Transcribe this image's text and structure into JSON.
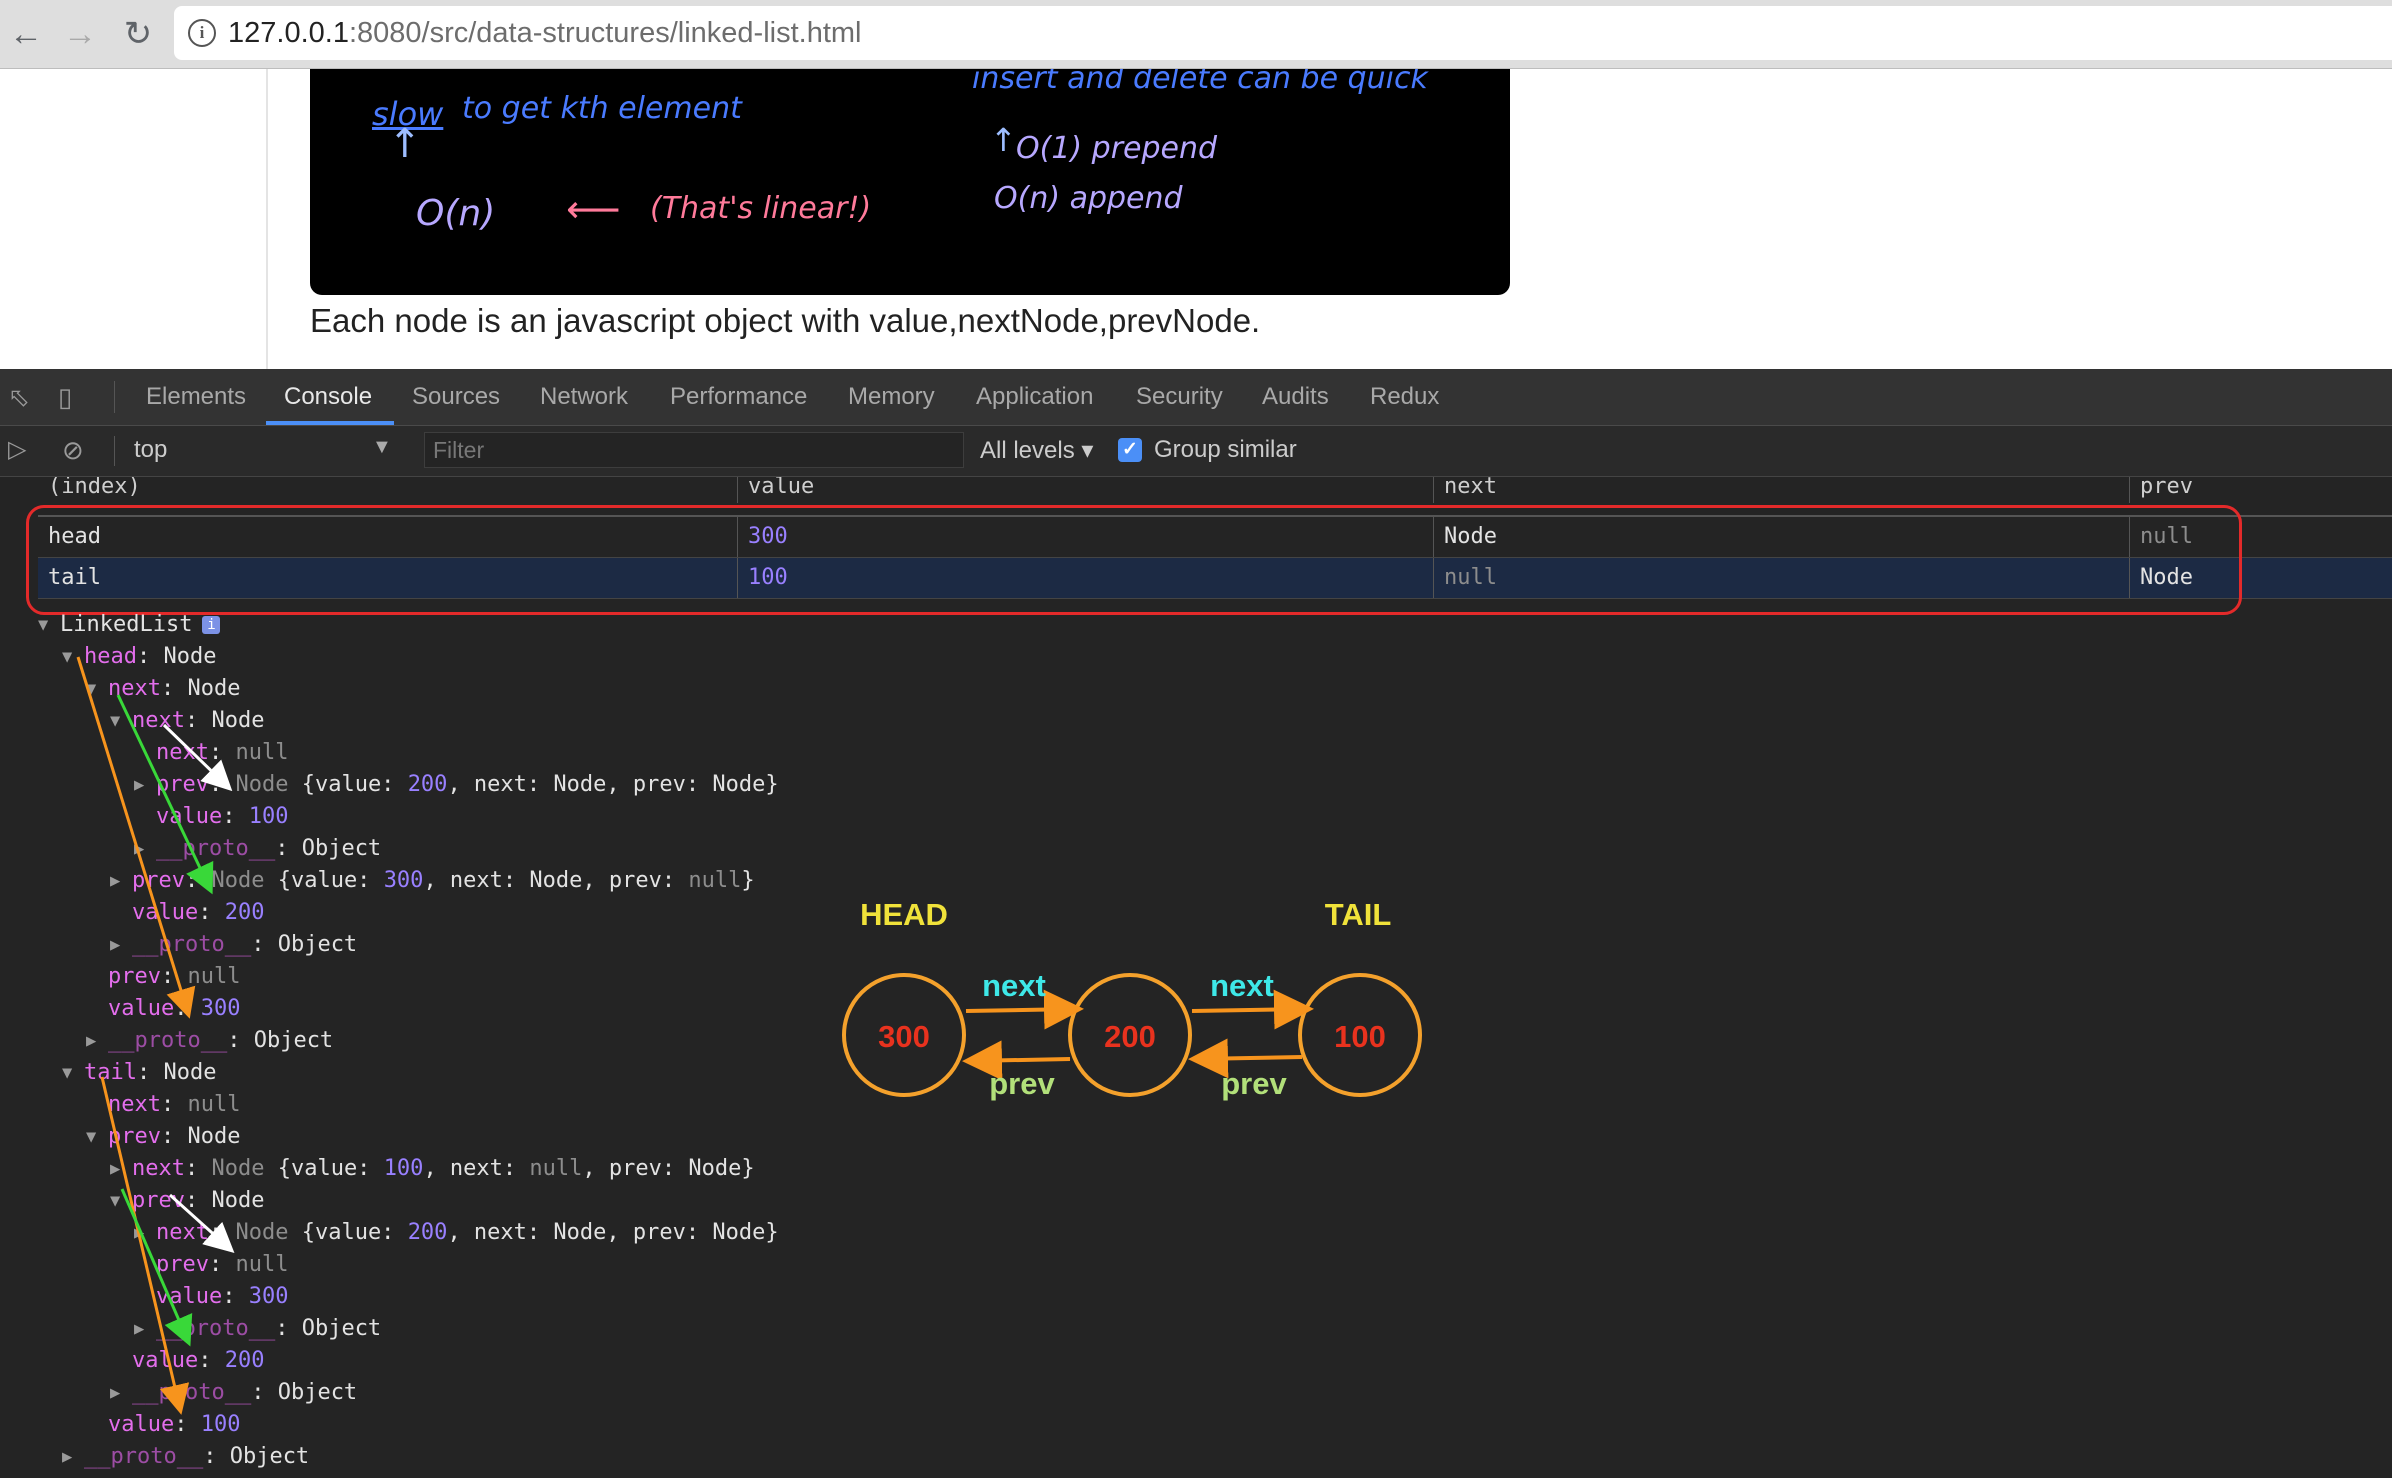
{
  "browser": {
    "url_host": "127.0.0.1",
    "url_rest": ":8080/src/data-structures/linked-list.html",
    "back_icon": "arrow-left-icon",
    "forward_icon": "arrow-right-icon",
    "reload_icon": "reload-icon"
  },
  "whiteboard": {
    "slow_text": "slow",
    "to_get_text": "to get kth element",
    "on_text": "O(n)",
    "linear_text": "(That's linear!)",
    "insert_text": "insert and delete can be quick",
    "prepend_text": "O(1) prepend",
    "append_text": "O(n) append"
  },
  "page_text": "Each node is an javascript object with value,nextNode,prevNode.",
  "devtools": {
    "tabs": [
      "Elements",
      "Console",
      "Sources",
      "Network",
      "Performance",
      "Memory",
      "Application",
      "Security",
      "Audits",
      "Redux"
    ],
    "active_tab": "Console",
    "context": "top",
    "filter_placeholder": "Filter",
    "levels": "All levels ▾",
    "group_similar": "Group similar"
  },
  "table": {
    "headers": [
      "(index)",
      "value",
      "next",
      "prev"
    ],
    "rows": [
      {
        "index": "head",
        "value": "300",
        "next": "Node",
        "prev": "null"
      },
      {
        "index": "tail",
        "value": "100",
        "next": "null",
        "prev": "Node"
      }
    ]
  },
  "tree_root": "LinkedList",
  "diagram": {
    "head_label": "HEAD",
    "tail_label": "TAIL",
    "nodes": [
      "300",
      "200",
      "100"
    ],
    "next_label": "next",
    "prev_label": "prev",
    "colors": {
      "circle": "#f4a12c",
      "value": "#e8321e",
      "label": "#f0e23a",
      "next": "#3ee8e8",
      "prev": "#b2e07a",
      "arrow": "#f7941d"
    }
  },
  "annotation_colors": {
    "orange": "#f7941d",
    "green": "#39d839",
    "white": "#ffffff",
    "redbox": "#e32a2a"
  }
}
